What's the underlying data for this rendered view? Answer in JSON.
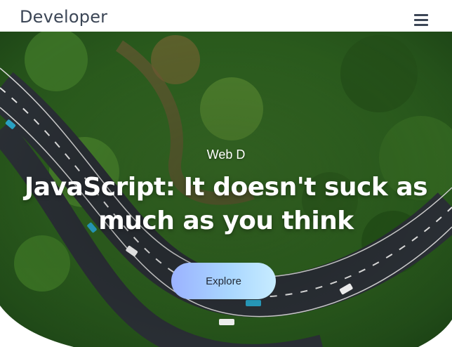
{
  "header": {
    "brand": "Developer",
    "menu_icon": "hamburger-menu-icon"
  },
  "hero": {
    "kicker": "Web D",
    "title": "JavaScript: It doesn't suck as much as you think",
    "cta_label": "Explore",
    "background": "aerial-forest-road-photo"
  },
  "colors": {
    "brand_text": "#3c4656",
    "cta_gradient_start": "#9bb2ff",
    "cta_gradient_end": "#c7ecff",
    "foliage": "#2f6b1f",
    "road": "#2b3036"
  }
}
